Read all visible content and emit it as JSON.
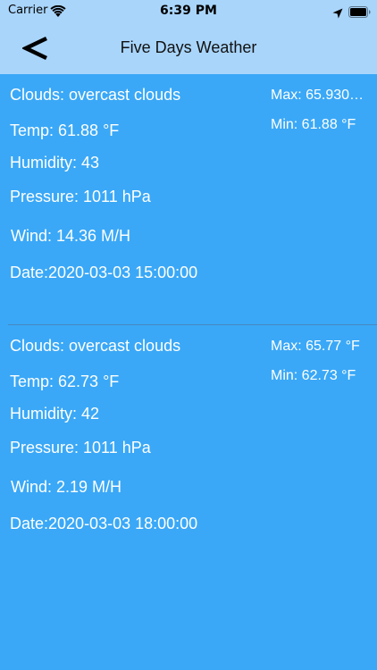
{
  "status_bar": {
    "carrier": "Carrier",
    "time": "6:39 PM"
  },
  "nav": {
    "back_label": "<",
    "title": "Five Days Weather"
  },
  "colors": {
    "background": "#3aa8f7",
    "nav_background": "#a9d5fb",
    "text": "#ffffff"
  },
  "forecasts": [
    {
      "clouds": "Clouds: overcast clouds",
      "temp": "Temp: 61.88 °F",
      "humidity": "Humidity: 43",
      "pressure": "Pressure: 1011 hPa",
      "wind": "Wind: 14.36 M/H",
      "date": "Date:2020-03-03 15:00:00",
      "max": "Max: 65.930…",
      "min": "Min: 61.88 °F"
    },
    {
      "clouds": "Clouds: overcast clouds",
      "temp": "Temp: 62.73 °F",
      "humidity": "Humidity: 42",
      "pressure": "Pressure: 1011 hPa",
      "wind": "Wind: 2.19 M/H",
      "date": "Date:2020-03-03 18:00:00",
      "max": "Max: 65.77 °F",
      "min": "Min: 62.73 °F"
    }
  ]
}
